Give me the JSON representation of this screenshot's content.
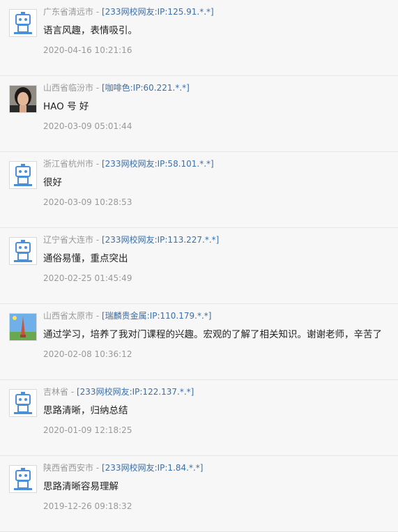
{
  "comments": [
    {
      "location": "广东省清远市",
      "separator": " - ",
      "user": "[233网校网友:IP:125.91.*.*]",
      "text": "语言风趣，表情吸引。",
      "time": "2020-04-16 10:21:16",
      "avatar": "robot-avatar"
    },
    {
      "location": "山西省临汾市",
      "separator": " - ",
      "user": "[咖啡色:IP:60.221.*.*]",
      "text": "HAO 号 好",
      "time": "2020-03-09 05:01:44",
      "avatar": "user-photo-avatar"
    },
    {
      "location": "浙江省杭州市",
      "separator": " - ",
      "user": "[233网校网友:IP:58.101.*.*]",
      "text": "很好",
      "time": "2020-03-09 10:28:53",
      "avatar": "robot-avatar"
    },
    {
      "location": "辽宁省大连市",
      "separator": " - ",
      "user": "[233网校网友:IP:113.227.*.*]",
      "text": "通俗易懂，重点突出",
      "time": "2020-02-25 01:45:49",
      "avatar": "robot-avatar"
    },
    {
      "location": "山西省太原市",
      "separator": " - ",
      "user": "[瑞麟贵金属:IP:110.179.*.*]",
      "text": "通过学习，培养了我对门课程的兴趣。宏观的了解了相关知识。谢谢老师，辛苦了",
      "time": "2020-02-08 10:36:12",
      "avatar": "tower-photo-avatar"
    },
    {
      "location": "吉林省",
      "separator": " - ",
      "user": "[233网校网友:IP:122.137.*.*]",
      "text": "思路清晰，归纳总结",
      "time": "2020-01-09 12:18:25",
      "avatar": "robot-avatar"
    },
    {
      "location": "陕西省西安市",
      "separator": " - ",
      "user": "[233网校网友:IP:1.84.*.*]",
      "text": "思路清晰容易理解",
      "time": "2019-12-26 09:18:32",
      "avatar": "robot-avatar"
    }
  ],
  "colors": {
    "background": "#f7f7f7",
    "meta_gray": "#999999",
    "user_link": "#3b6fa8",
    "text": "#222222"
  }
}
